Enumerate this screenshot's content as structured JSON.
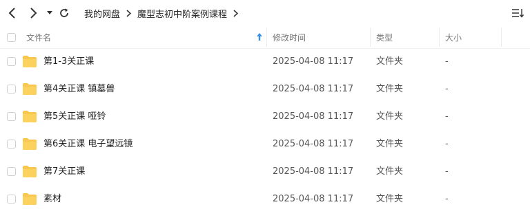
{
  "breadcrumb": [
    "我的网盘",
    "魔型志初中阶案例课程"
  ],
  "columns": {
    "name": "文件名",
    "modified": "修改时间",
    "type": "类型",
    "size": "大小"
  },
  "files": [
    {
      "name": "第1-3关正课",
      "modified": "2025-04-08 11:17",
      "type": "文件夹",
      "size": "-"
    },
    {
      "name": "第4关正课 镇墓兽",
      "modified": "2025-04-08 11:17",
      "type": "文件夹",
      "size": "-"
    },
    {
      "name": "第5关正课 哑铃",
      "modified": "2025-04-08 11:17",
      "type": "文件夹",
      "size": "-"
    },
    {
      "name": "第6关正课 电子望远镜",
      "modified": "2025-04-08 11:17",
      "type": "文件夹",
      "size": "-"
    },
    {
      "name": "第7关正课",
      "modified": "2025-04-08 11:17",
      "type": "文件夹",
      "size": "-"
    },
    {
      "name": "素材",
      "modified": "2025-04-08 11:17",
      "type": "文件夹",
      "size": "-"
    }
  ],
  "icons": {
    "back": "chevron-left-icon",
    "forward": "chevron-right-icon",
    "history": "caret-down-icon",
    "refresh": "refresh-icon",
    "separator": "chevron-right-icon",
    "sort_menu": "sort-menu-icon",
    "sort_indicator": "sort-up-arrow-icon",
    "folder": "folder-icon"
  },
  "colors": {
    "folder": "#f9c74f",
    "sort_arrow": "#3a8ee6",
    "separator_line": "#ececec"
  }
}
